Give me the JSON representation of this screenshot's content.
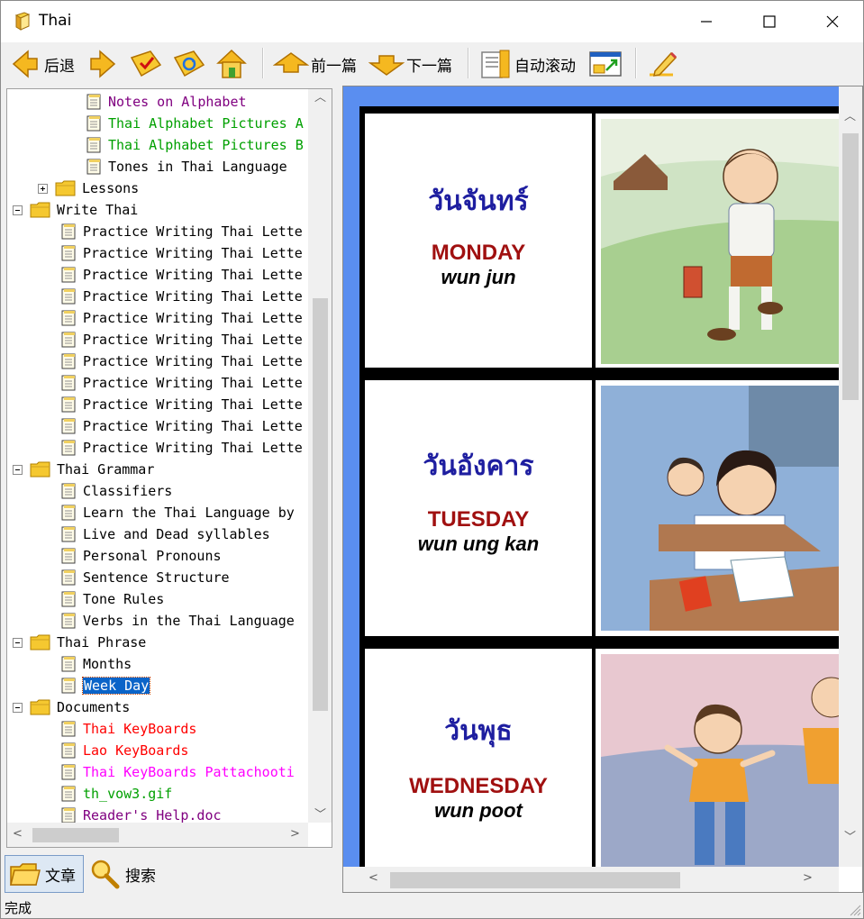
{
  "window": {
    "title": "Thai",
    "icon": "book-icon"
  },
  "toolbar": {
    "back_label": "后退",
    "prev_label": "前一篇",
    "next_label": "下一篇",
    "autoscroll_label": "自动滚动"
  },
  "tree": {
    "rows": [
      {
        "label": "Notes on Alphabet",
        "color": "purple",
        "type": "doc",
        "level": 3
      },
      {
        "label": "Thai Alphabet Pictures A",
        "color": "green",
        "type": "doc",
        "level": 3
      },
      {
        "label": "Thai Alphabet Pictures B",
        "color": "green",
        "type": "doc",
        "level": 3
      },
      {
        "label": "Tones in Thai Language",
        "color": "black",
        "type": "doc",
        "level": 3
      },
      {
        "label": "Lessons",
        "color": "black",
        "type": "folder",
        "level": 2,
        "expanded": false
      },
      {
        "label": "Write Thai",
        "color": "black",
        "type": "folder",
        "level": 1,
        "expanded": true
      },
      {
        "label": "Practice Writing Thai Lette",
        "color": "black",
        "type": "doc",
        "level": 2
      },
      {
        "label": "Practice Writing Thai Lette",
        "color": "black",
        "type": "doc",
        "level": 2
      },
      {
        "label": "Practice Writing Thai Lette",
        "color": "black",
        "type": "doc",
        "level": 2
      },
      {
        "label": "Practice Writing Thai Lette",
        "color": "black",
        "type": "doc",
        "level": 2
      },
      {
        "label": "Practice Writing Thai Lette",
        "color": "black",
        "type": "doc",
        "level": 2
      },
      {
        "label": "Practice Writing Thai Lette",
        "color": "black",
        "type": "doc",
        "level": 2
      },
      {
        "label": "Practice Writing Thai Lette",
        "color": "black",
        "type": "doc",
        "level": 2
      },
      {
        "label": "Practice Writing Thai Lette",
        "color": "black",
        "type": "doc",
        "level": 2
      },
      {
        "label": "Practice Writing Thai Lette",
        "color": "black",
        "type": "doc",
        "level": 2
      },
      {
        "label": "Practice Writing Thai Lette",
        "color": "black",
        "type": "doc",
        "level": 2
      },
      {
        "label": "Practice Writing Thai Lette",
        "color": "black",
        "type": "doc",
        "level": 2
      },
      {
        "label": "Thai Grammar",
        "color": "black",
        "type": "folder",
        "level": 1,
        "expanded": true
      },
      {
        "label": "Classifiers",
        "color": "black",
        "type": "doc",
        "level": 2
      },
      {
        "label": "Learn the Thai Language by",
        "color": "black",
        "type": "doc",
        "level": 2
      },
      {
        "label": "Live and Dead syllables",
        "color": "black",
        "type": "doc",
        "level": 2
      },
      {
        "label": "Personal Pronouns",
        "color": "black",
        "type": "doc",
        "level": 2
      },
      {
        "label": "Sentence Structure",
        "color": "black",
        "type": "doc",
        "level": 2
      },
      {
        "label": "Tone Rules",
        "color": "black",
        "type": "doc",
        "level": 2
      },
      {
        "label": "Verbs in the Thai Language",
        "color": "black",
        "type": "doc",
        "level": 2
      },
      {
        "label": "Thai Phrase",
        "color": "black",
        "type": "folder",
        "level": 1,
        "expanded": true
      },
      {
        "label": "Months",
        "color": "black",
        "type": "doc",
        "level": 2
      },
      {
        "label": "Week Day",
        "color": "black",
        "type": "doc",
        "level": 2,
        "selected": true
      },
      {
        "label": "Documents",
        "color": "black",
        "type": "folder",
        "level": 1,
        "expanded": true
      },
      {
        "label": "Thai KeyBoards",
        "color": "red",
        "type": "doc",
        "level": 2
      },
      {
        "label": "Lao KeyBoards",
        "color": "red",
        "type": "doc",
        "level": 2
      },
      {
        "label": "Thai KeyBoards Pattachooti",
        "color": "magenta",
        "type": "doc",
        "level": 2
      },
      {
        "label": "th_vow3.gif",
        "color": "green",
        "type": "doc",
        "level": 2
      },
      {
        "label": "Reader's Help.doc",
        "color": "purple",
        "type": "doc",
        "level": 2
      }
    ]
  },
  "tabs": {
    "articles_label": "文章",
    "search_label": "搜索"
  },
  "status": {
    "text": "完成"
  },
  "content": {
    "days": [
      {
        "thai": "วันจันทร์",
        "english": "MONDAY",
        "transliteration": "wun jun"
      },
      {
        "thai": "วันอังคาร",
        "english": "TUESDAY",
        "transliteration": "wun ung kan"
      },
      {
        "thai": "วันพุธ",
        "english": "WEDNESDAY",
        "transliteration": "wun poot"
      }
    ]
  },
  "colors": {
    "content_background": "#5a8ef0",
    "thai_text": "#1e1ea0",
    "english_text": "#a01010",
    "selection": "#0a64c8"
  }
}
